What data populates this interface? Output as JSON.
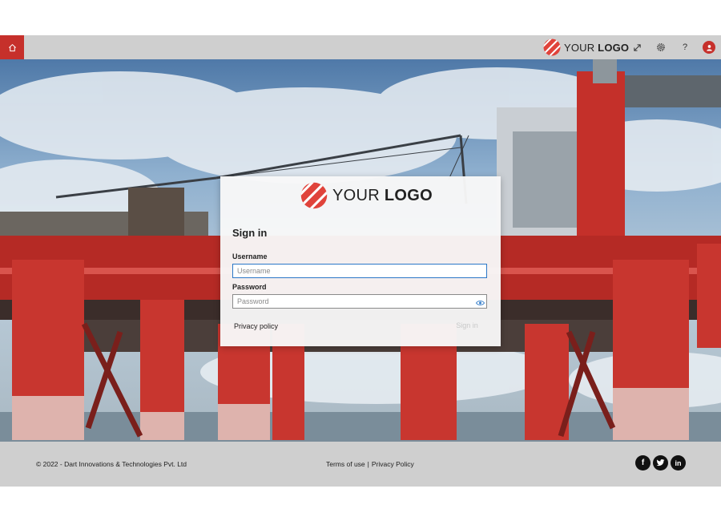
{
  "header": {
    "logo_light": "YOUR",
    "logo_bold": "LOGO",
    "icons": [
      "home-icon",
      "expand-icon",
      "gear-icon",
      "help-icon",
      "user-avatar-icon"
    ],
    "help_glyph": "?",
    "accent_color": "#c6302b"
  },
  "login": {
    "logo_light": "YOUR",
    "logo_bold": "LOGO",
    "title": "Sign in",
    "username_label": "Username",
    "username_placeholder": "Username",
    "username_value": "",
    "password_label": "Password",
    "password_placeholder": "Password",
    "password_value": "",
    "privacy_link": "Privacy policy",
    "signin_button": "Sign in"
  },
  "footer": {
    "copyright": "© 2022 - Dart Innovations & Technologies Pvt. Ltd",
    "terms": "Terms of use",
    "separator": "|",
    "privacy": "Privacy Policy",
    "social": [
      {
        "name": "facebook",
        "glyph": "f"
      },
      {
        "name": "twitter",
        "glyph": "t"
      },
      {
        "name": "linkedin",
        "glyph": "in"
      }
    ]
  }
}
